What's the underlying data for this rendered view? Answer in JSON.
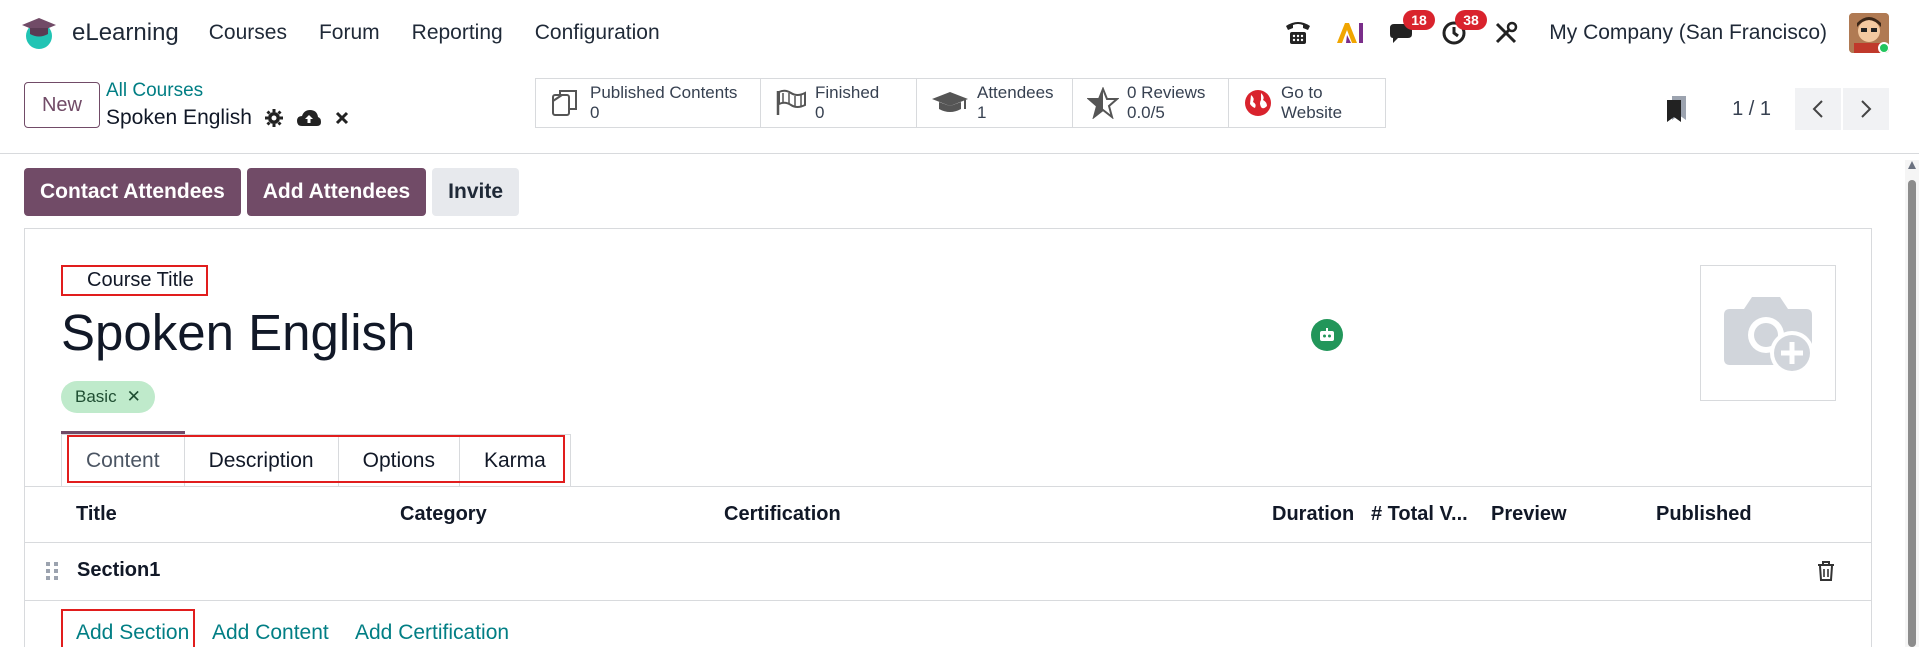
{
  "navbar": {
    "app_name": "eLearning",
    "menu": [
      "Courses",
      "Forum",
      "Reporting",
      "Configuration"
    ],
    "badges": {
      "chat": "18",
      "activity": "38"
    },
    "company": "My Company (San Francisco)"
  },
  "control_panel": {
    "new_label": "New",
    "breadcrumb_parent": "All Courses",
    "breadcrumb_current": "Spoken English",
    "smart_buttons": [
      {
        "label": "Published Contents",
        "value": "0",
        "icon": "copy-icon"
      },
      {
        "label": "Finished",
        "value": "0",
        "icon": "flag-icon"
      },
      {
        "label": "Attendees",
        "value": "1",
        "icon": "graduation-cap-icon"
      },
      {
        "label": "0 Reviews",
        "value": "0.0/5",
        "icon": "star-icon"
      },
      {
        "label": "Go to",
        "value": "Website",
        "icon": "globe-icon"
      }
    ],
    "pager": "1 / 1"
  },
  "statusbar": {
    "contact_attendees": "Contact Attendees",
    "add_attendees": "Add Attendees",
    "invite": "Invite"
  },
  "form": {
    "title_label": "Course Title",
    "course_name": "Spoken English",
    "tag": "Basic",
    "tabs": [
      "Content",
      "Description",
      "Options",
      "Karma"
    ],
    "columns": [
      "Title",
      "Category",
      "Certification",
      "Duration",
      "# Total V...",
      "Preview",
      "Published"
    ],
    "rows": [
      {
        "title": "Section1"
      }
    ],
    "actions": [
      "Add Section",
      "Add Content",
      "Add Certification"
    ]
  },
  "colors": {
    "primary": "#714b67",
    "link": "#017e84",
    "highlight": "#e11d1d"
  }
}
